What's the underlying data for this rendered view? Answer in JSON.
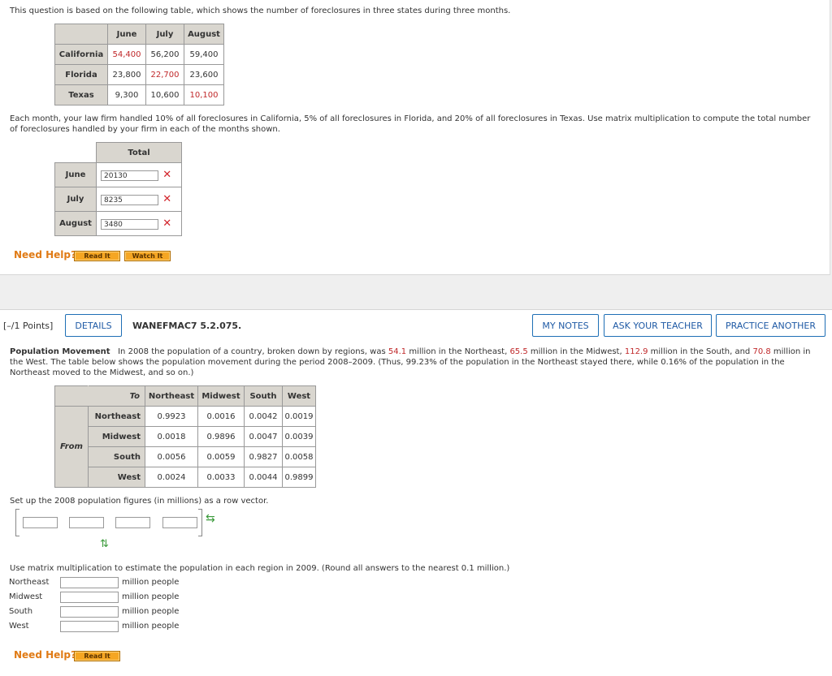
{
  "q1": {
    "intro": "This question is based on the following table, which shows the number of foreclosures in three states during three months.",
    "table": {
      "headers": [
        "June",
        "July",
        "August"
      ],
      "rows": [
        {
          "label": "California",
          "values": [
            "54,400",
            "56,200",
            "59,400"
          ]
        },
        {
          "label": "Florida",
          "values": [
            "23,800",
            "22,700",
            "23,600"
          ]
        },
        {
          "label": "Texas",
          "values": [
            "9,300",
            "10,600",
            "10,100"
          ]
        }
      ]
    },
    "prompt": "Each month, your law firm handled 10% of all foreclosures in California, 5% of all foreclosures in Florida, and 20% of all foreclosures in Texas. Use matrix multiplication to compute the total number of foreclosures handled by your firm in each of the months shown.",
    "answer_table": {
      "header": "Total",
      "rows": [
        {
          "label": "June",
          "value": "20130"
        },
        {
          "label": "July",
          "value": "8235"
        },
        {
          "label": "August",
          "value": "3480"
        }
      ]
    },
    "need_help": "Need Help?",
    "read_it": "Read It",
    "watch_it": "Watch It"
  },
  "q2": {
    "points": "[–/1 Points]",
    "details": "DETAILS",
    "code": "WANEFMAC7 5.2.075.",
    "my_notes": "MY NOTES",
    "ask_teacher": "ASK YOUR TEACHER",
    "practice": "PRACTICE ANOTHER",
    "title": "Population Movement",
    "text_a": "In 2008 the population of a country, broken down by regions, was ",
    "v_ne": "54.1",
    "text_b": " million in the Northeast, ",
    "v_mw": "65.5",
    "text_c": " million in the Midwest, ",
    "v_s": "112.9",
    "text_d": " million in the South, and ",
    "v_w": "70.8",
    "text_e": " million in the West. The table below shows the population movement during the period 2008–2009. (Thus, 99.23% of the population in the Northeast stayed there, while 0.16% of the population in the Northeast moved to the Midwest, and so on.)",
    "matrix": {
      "to_label": "To",
      "from_label": "From",
      "cols": [
        "Northeast",
        "Midwest",
        "South",
        "West"
      ],
      "rows": [
        {
          "label": "Northeast",
          "values": [
            "0.9923",
            "0.0016",
            "0.0042",
            "0.0019"
          ]
        },
        {
          "label": "Midwest",
          "values": [
            "0.0018",
            "0.9896",
            "0.0047",
            "0.0039"
          ]
        },
        {
          "label": "South",
          "values": [
            "0.0056",
            "0.0059",
            "0.9827",
            "0.0058"
          ]
        },
        {
          "label": "West",
          "values": [
            "0.0024",
            "0.0033",
            "0.0044",
            "0.9899"
          ]
        }
      ]
    },
    "vector_prompt": "Set up the 2008 population figures (in millions) as a row vector.",
    "estimate_prompt": "Use matrix multiplication to estimate the population in each region in 2009. (Round all answers to the nearest 0.1 million.)",
    "answers": [
      {
        "label": "Northeast",
        "unit": "million people"
      },
      {
        "label": "Midwest",
        "unit": "million people"
      },
      {
        "label": "South",
        "unit": "million people"
      },
      {
        "label": "West",
        "unit": "million people"
      }
    ],
    "need_help": "Need Help?",
    "read_it": "Read It"
  },
  "icons": {
    "wrong": "✕",
    "arrows": "⇆",
    "updown": "⇅"
  },
  "colors": {
    "accent_orange": "#f5a623",
    "link_blue": "#1f5aa5",
    "error_red": "#d2232a",
    "highlight_red": "#c0282a"
  }
}
